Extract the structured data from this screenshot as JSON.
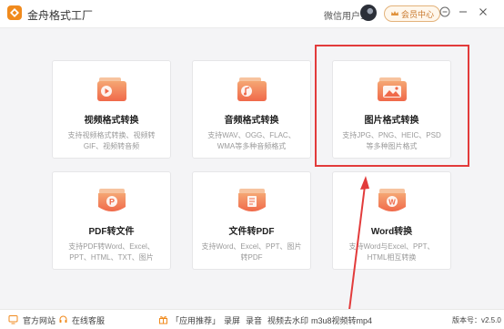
{
  "titlebar": {
    "app_title": "金舟格式工厂",
    "username": "微信用户1",
    "vip_label": "会员中心"
  },
  "cards": [
    {
      "title": "视频格式转换",
      "desc": "支持视频格式转换、视频转GIF、视频转音频",
      "icon": "video-icon"
    },
    {
      "title": "音频格式转换",
      "desc": "支持WAV、OGG、FLAC、WMA等多种音频格式",
      "icon": "music-icon"
    },
    {
      "title": "图片格式转换",
      "desc": "支持JPG、PNG、HEIC、PSD等多种图片格式",
      "icon": "image-icon"
    },
    {
      "title": "PDF转文件",
      "desc": "支持PDF转Word、Excel、PPT、HTML、TXT、图片",
      "icon": "ppt-icon"
    },
    {
      "title": "文件转PDF",
      "desc": "支持Word、Excel、PPT、图片转PDF",
      "icon": "document-icon"
    },
    {
      "title": "Word转换",
      "desc": "支持Word与Excel、PPT、HTML相互转换",
      "icon": "word-icon"
    }
  ],
  "statusbar": {
    "website": "官方网站",
    "service": "在线客服",
    "apps_tag": "「应用推荐」",
    "apps": [
      "录屏",
      "录音",
      "视频去水印",
      "m3u8视频转mp4"
    ],
    "version": "版本号：v2.5.0"
  },
  "colors": {
    "accent": "#f08a1d",
    "highlight": "#e23b3b",
    "icon_top": "#f5a673",
    "icon_bottom": "#f0694a"
  }
}
